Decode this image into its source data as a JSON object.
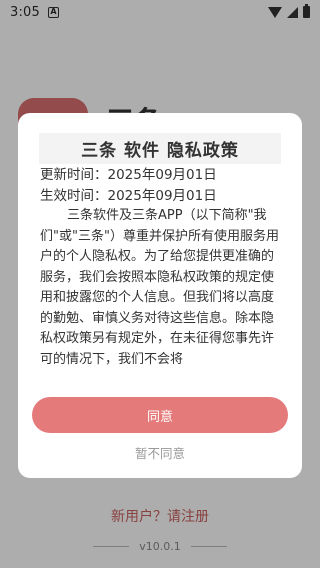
{
  "status_bar": {
    "time": "3:05",
    "notification_glyph": "A"
  },
  "app": {
    "name": "三条",
    "register_link": "新用户？请注册",
    "version": "v10.0.1",
    "logo_color": "#d96f6f"
  },
  "dialog": {
    "title": "三条 软件 隐私政策",
    "updated": "更新时间：2025年09月01日",
    "effective": "生效时间：2025年09月01日",
    "body": "三条软件及三条APP（以下简称\"我们\"或\"三条\"）尊重并保护所有使用服务用户的个人隐私权。为了给您提供更准确的服务，我们会按照本隐私权政策的规定使用和披露您的个人信息。但我们将以高度的勤勉、审慎义务对待这些信息。除本隐私权政策另有规定外，在未征得您事先许可的情况下，我们不会将",
    "agree_label": "同意",
    "disagree_label": "暂不同意",
    "accent_color": "#e57a7a"
  }
}
